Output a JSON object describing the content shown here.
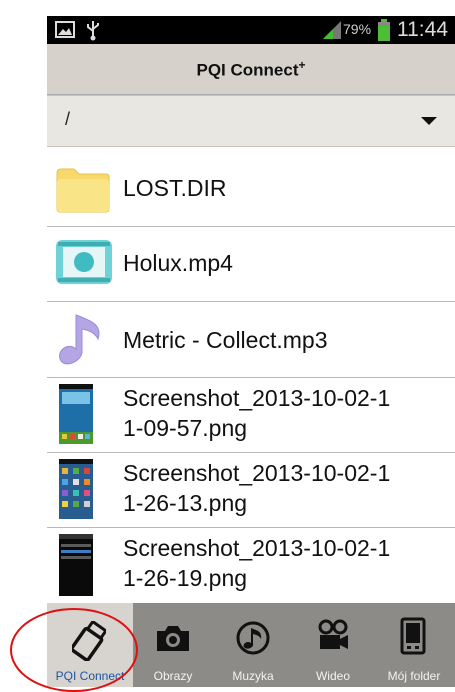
{
  "status": {
    "battery": "79%",
    "time": "11:44"
  },
  "header": {
    "title": "PQI Connect",
    "title_sup": "+"
  },
  "path_selector": {
    "value": "/"
  },
  "files": [
    {
      "name": "LOST.DIR",
      "icon": "folder-icon"
    },
    {
      "name": "Holux.mp4",
      "icon": "video-file-icon"
    },
    {
      "name": "Metric - Collect.mp3",
      "icon": "music-file-icon"
    },
    {
      "name_line1": "Screenshot_2013-10-02-1",
      "name_line2": "1-09-57.png",
      "icon": "image-thumbnail"
    },
    {
      "name_line1": "Screenshot_2013-10-02-1",
      "name_line2": "1-26-13.png",
      "icon": "image-thumbnail"
    },
    {
      "name_line1": "Screenshot_2013-10-02-1",
      "name_line2": "1-26-19.png",
      "icon": "image-thumbnail"
    }
  ],
  "tabs": [
    {
      "label": "PQI Connect",
      "icon": "usb-drive-icon",
      "active": true
    },
    {
      "label": "Obrazy",
      "icon": "camera-icon"
    },
    {
      "label": "Muzyka",
      "icon": "music-disc-icon"
    },
    {
      "label": "Wideo",
      "icon": "video-camera-icon"
    },
    {
      "label": "Mój folder",
      "icon": "phone-folder-icon"
    }
  ],
  "colors": {
    "accent": "#1f55a4",
    "annotation": "#dd1111"
  }
}
